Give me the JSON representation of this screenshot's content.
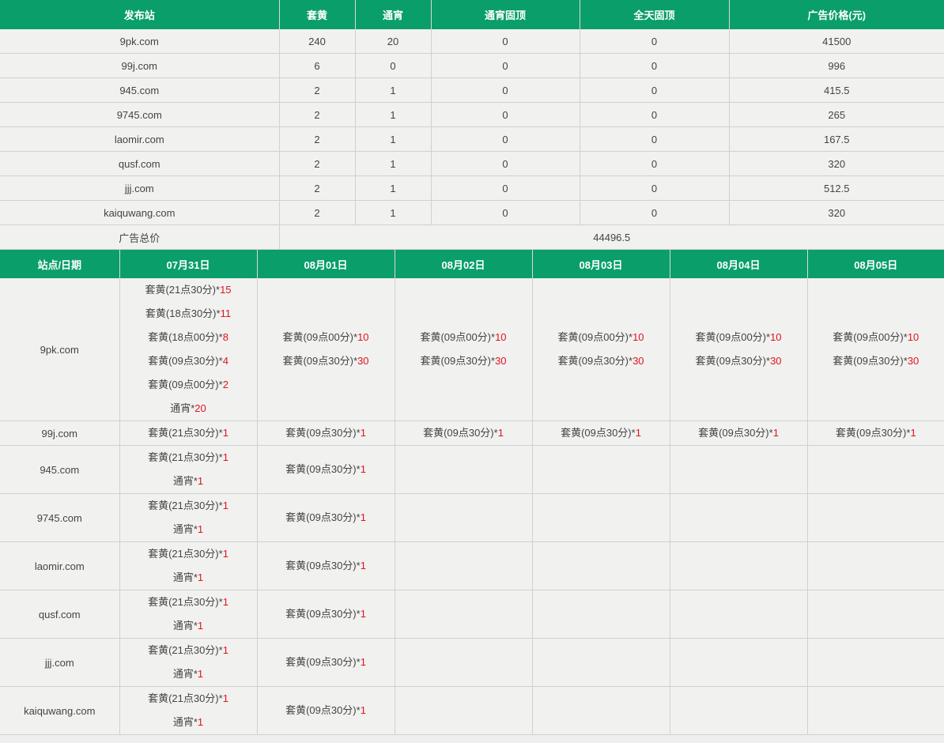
{
  "summary": {
    "headers": [
      "发布站",
      "套黄",
      "通宵",
      "通宵固顶",
      "全天固顶",
      "广告价格(元)"
    ],
    "rows": [
      [
        "9pk.com",
        "240",
        "20",
        "0",
        "0",
        "41500"
      ],
      [
        "99j.com",
        "6",
        "0",
        "0",
        "0",
        "996"
      ],
      [
        "945.com",
        "2",
        "1",
        "0",
        "0",
        "415.5"
      ],
      [
        "9745.com",
        "2",
        "1",
        "0",
        "0",
        "265"
      ],
      [
        "laomir.com",
        "2",
        "1",
        "0",
        "0",
        "167.5"
      ],
      [
        "qusf.com",
        "2",
        "1",
        "0",
        "0",
        "320"
      ],
      [
        "jjj.com",
        "2",
        "1",
        "0",
        "0",
        "512.5"
      ],
      [
        "kaiquwang.com",
        "2",
        "1",
        "0",
        "0",
        "320"
      ]
    ],
    "total_label": "广告总价",
    "total_value": "44496.5"
  },
  "schedule": {
    "headers": [
      "站点/日期",
      "07月31日",
      "08月01日",
      "08月02日",
      "08月03日",
      "08月04日",
      "08月05日"
    ],
    "rows": [
      {
        "site": "9pk.com",
        "cells": [
          [
            {
              "text": "套黄(21点30分)*",
              "count": "15"
            },
            {
              "text": "套黄(18点30分)*",
              "count": "11"
            },
            {
              "text": "套黄(18点00分)*",
              "count": "8"
            },
            {
              "text": "套黄(09点30分)*",
              "count": "4"
            },
            {
              "text": "套黄(09点00分)*",
              "count": "2"
            },
            {
              "text": "通宵*",
              "count": "20"
            }
          ],
          [
            {
              "text": "套黄(09点00分)*",
              "count": "10"
            },
            {
              "text": "套黄(09点30分)*",
              "count": "30"
            }
          ],
          [
            {
              "text": "套黄(09点00分)*",
              "count": "10"
            },
            {
              "text": "套黄(09点30分)*",
              "count": "30"
            }
          ],
          [
            {
              "text": "套黄(09点00分)*",
              "count": "10"
            },
            {
              "text": "套黄(09点30分)*",
              "count": "30"
            }
          ],
          [
            {
              "text": "套黄(09点00分)*",
              "count": "10"
            },
            {
              "text": "套黄(09点30分)*",
              "count": "30"
            }
          ],
          [
            {
              "text": "套黄(09点00分)*",
              "count": "10"
            },
            {
              "text": "套黄(09点30分)*",
              "count": "30"
            }
          ]
        ]
      },
      {
        "site": "99j.com",
        "cells": [
          [
            {
              "text": "套黄(21点30分)*",
              "count": "1"
            }
          ],
          [
            {
              "text": "套黄(09点30分)*",
              "count": "1"
            }
          ],
          [
            {
              "text": "套黄(09点30分)*",
              "count": "1"
            }
          ],
          [
            {
              "text": "套黄(09点30分)*",
              "count": "1"
            }
          ],
          [
            {
              "text": "套黄(09点30分)*",
              "count": "1"
            }
          ],
          [
            {
              "text": "套黄(09点30分)*",
              "count": "1"
            }
          ]
        ]
      },
      {
        "site": "945.com",
        "cells": [
          [
            {
              "text": "套黄(21点30分)*",
              "count": "1"
            },
            {
              "text": "通宵*",
              "count": "1"
            }
          ],
          [
            {
              "text": "套黄(09点30分)*",
              "count": "1"
            }
          ],
          [],
          [],
          [],
          []
        ]
      },
      {
        "site": "9745.com",
        "cells": [
          [
            {
              "text": "套黄(21点30分)*",
              "count": "1"
            },
            {
              "text": "通宵*",
              "count": "1"
            }
          ],
          [
            {
              "text": "套黄(09点30分)*",
              "count": "1"
            }
          ],
          [],
          [],
          [],
          []
        ]
      },
      {
        "site": "laomir.com",
        "cells": [
          [
            {
              "text": "套黄(21点30分)*",
              "count": "1"
            },
            {
              "text": "通宵*",
              "count": "1"
            }
          ],
          [
            {
              "text": "套黄(09点30分)*",
              "count": "1"
            }
          ],
          [],
          [],
          [],
          []
        ]
      },
      {
        "site": "qusf.com",
        "cells": [
          [
            {
              "text": "套黄(21点30分)*",
              "count": "1"
            },
            {
              "text": "通宵*",
              "count": "1"
            }
          ],
          [
            {
              "text": "套黄(09点30分)*",
              "count": "1"
            }
          ],
          [],
          [],
          [],
          []
        ]
      },
      {
        "site": "jjj.com",
        "cells": [
          [
            {
              "text": "套黄(21点30分)*",
              "count": "1"
            },
            {
              "text": "通宵*",
              "count": "1"
            }
          ],
          [
            {
              "text": "套黄(09点30分)*",
              "count": "1"
            }
          ],
          [],
          [],
          [],
          []
        ]
      },
      {
        "site": "kaiquwang.com",
        "cells": [
          [
            {
              "text": "套黄(21点30分)*",
              "count": "1"
            },
            {
              "text": "通宵*",
              "count": "1"
            }
          ],
          [
            {
              "text": "套黄(09点30分)*",
              "count": "1"
            }
          ],
          [],
          [],
          [],
          []
        ]
      }
    ]
  },
  "colors": {
    "header_bg": "#0a9e6b",
    "count_red": "#e0141d",
    "cell_bg": "#f1f1f0"
  }
}
